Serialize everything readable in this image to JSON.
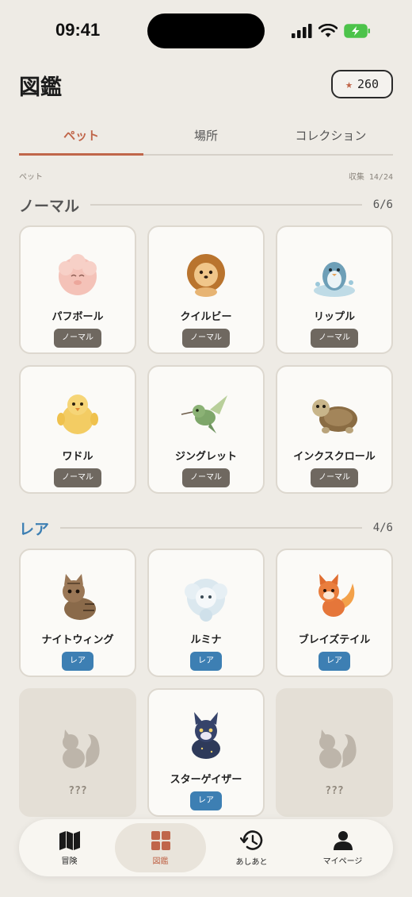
{
  "status": {
    "time": "09:41"
  },
  "header": {
    "title": "図鑑",
    "coins": "260"
  },
  "tabs": [
    {
      "label": "ペット",
      "active": true
    },
    {
      "label": "場所",
      "active": false
    },
    {
      "label": "コレクション",
      "active": false
    }
  ],
  "meta": {
    "left": "ペット",
    "right": "収集 14/24"
  },
  "sections": {
    "normal": {
      "title": "ノーマル",
      "count": "6/6",
      "color": "#555555",
      "pets": [
        {
          "name": "パフボール",
          "rarity": "ノーマル",
          "icon": "pink-fluffball"
        },
        {
          "name": "クイルビー",
          "rarity": "ノーマル",
          "icon": "hedgehog"
        },
        {
          "name": "リップル",
          "rarity": "ノーマル",
          "icon": "blue-bird-splash"
        },
        {
          "name": "ワドル",
          "rarity": "ノーマル",
          "icon": "yellow-chick"
        },
        {
          "name": "ジングレット",
          "rarity": "ノーマル",
          "icon": "hummingbird"
        },
        {
          "name": "インクスクロール",
          "rarity": "ノーマル",
          "icon": "turtle"
        }
      ]
    },
    "rare": {
      "title": "レア",
      "count": "4/6",
      "color": "#3d7fb3",
      "pets": [
        {
          "name": "ナイトウィング",
          "rarity": "レア",
          "icon": "tabby-cat"
        },
        {
          "name": "ルミナ",
          "rarity": "レア",
          "icon": "cloud-spirit"
        },
        {
          "name": "ブレイズテイル",
          "rarity": "レア",
          "icon": "fire-fox"
        },
        {
          "name": "???",
          "locked": true,
          "icon": "squirrel-silhouette"
        },
        {
          "name": "スターゲイザー",
          "rarity": "レア",
          "icon": "star-wolf"
        },
        {
          "name": "???",
          "locked": true,
          "icon": "squirrel-silhouette"
        }
      ]
    }
  },
  "nav": [
    {
      "label": "冒険",
      "icon": "map-icon",
      "active": false
    },
    {
      "label": "図鑑",
      "icon": "grid-icon",
      "active": true
    },
    {
      "label": "あしあと",
      "icon": "history-icon",
      "active": false
    },
    {
      "label": "マイページ",
      "icon": "person-icon",
      "active": false
    }
  ],
  "colors": {
    "accent": "#c0664a",
    "rare": "#3d7fb3",
    "normal_chip": "#6f6860",
    "background": "#eeebe5"
  }
}
